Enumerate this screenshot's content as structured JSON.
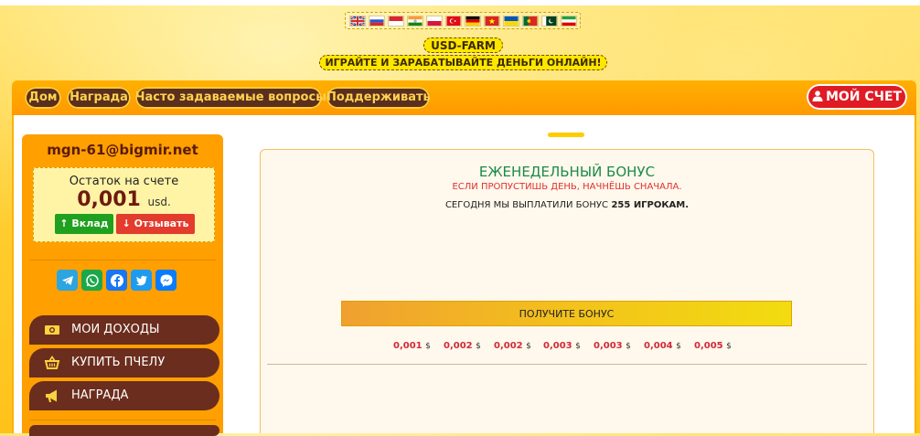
{
  "header": {
    "flags": [
      {
        "code": "gb",
        "colors": [
          "#1f3b8c",
          "#ffffff",
          "#d22c2c"
        ]
      },
      {
        "code": "ru",
        "colors": [
          "#ffffff",
          "#2a55d4",
          "#d52b1e"
        ]
      },
      {
        "code": "id",
        "colors": [
          "#d9262e",
          "#ffffff"
        ]
      },
      {
        "code": "in",
        "colors": [
          "#ff9933",
          "#ffffff",
          "#138808"
        ]
      },
      {
        "code": "pl",
        "colors": [
          "#ffffff",
          "#dc143c"
        ]
      },
      {
        "code": "tr",
        "colors": [
          "#e30a17"
        ]
      },
      {
        "code": "de",
        "colors": [
          "#000000",
          "#dd0000",
          "#ffce00"
        ]
      },
      {
        "code": "vn",
        "colors": [
          "#da251d"
        ]
      },
      {
        "code": "ua",
        "colors": [
          "#0057b7",
          "#ffd700"
        ]
      },
      {
        "code": "pt",
        "colors": [
          "#046a38",
          "#da291c"
        ]
      },
      {
        "code": "pk",
        "colors": [
          "#ffffff",
          "#01411c"
        ]
      },
      {
        "code": "ir",
        "colors": [
          "#239f40",
          "#ffffff",
          "#da0000"
        ]
      }
    ],
    "brand": "USD-FARM",
    "tagline": "ИГРАЙТЕ И ЗАРАБАТЫВАЙТЕ ДЕНЬГИ ОНЛАЙН!"
  },
  "nav": {
    "items": [
      "Дом",
      "Награда",
      "Часто задаваемые вопросы",
      "Поддерживать"
    ],
    "account": "МОЙ СЧЕТ"
  },
  "sidebar": {
    "email": "mgn-61@bigmir.net",
    "balance_label": "Остаток на счете",
    "balance_value": "0,001",
    "balance_unit": "usd.",
    "deposit": "Вклад",
    "withdraw": "Отзывать",
    "socials": [
      "telegram-icon",
      "whatsapp-icon",
      "facebook-icon",
      "twitter-icon",
      "messenger-icon"
    ],
    "menu": [
      {
        "label": "МОИ ДОХОДЫ",
        "icon": "money-icon"
      },
      {
        "label": "КУПИТЬ ПЧЕЛУ",
        "icon": "basket-icon"
      },
      {
        "label": "НАГРАДА",
        "icon": "megaphone-icon"
      }
    ]
  },
  "bonus": {
    "title": "ЕЖЕНЕДЕЛЬНЫЙ БОНУС",
    "warning": "ЕСЛИ ПРОПУСТИШЬ ДЕНЬ, НАЧНЁШЬ СНАЧАЛА.",
    "stat_prefix": "СЕГОДНЯ МЫ ВЫПЛАТИЛИ БОНУС",
    "stat_count": "255",
    "stat_suffix": "ИГРОКАМ.",
    "button": "ПОЛУЧИТЕ БОНУС",
    "amounts": [
      "0,001",
      "0,002",
      "0,002",
      "0,003",
      "0,003",
      "0,004",
      "0,005"
    ],
    "currency": "$"
  },
  "colors": {
    "accent_orange": "#ff9f00",
    "menu_brown": "#6b2d1d",
    "account_red": "#e01b24",
    "bonus_green": "#1c8a4a",
    "amount_red": "#d12a3a"
  }
}
